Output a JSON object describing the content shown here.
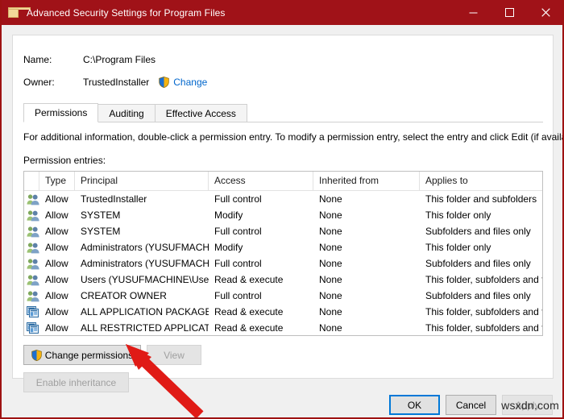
{
  "window": {
    "title": "Advanced Security Settings for Program Files",
    "icon": "folder-icon",
    "titlebar_color": "#a01218",
    "controls": {
      "minimize": "minimize-icon",
      "maximize": "maximize-icon",
      "close": "close-icon"
    }
  },
  "header": {
    "name_label": "Name:",
    "name_value": "C:\\Program Files",
    "owner_label": "Owner:",
    "owner_value": "TrustedInstaller",
    "owner_change_link": "Change",
    "shield_icon": "uac-shield-icon"
  },
  "tabs": [
    {
      "label": "Permissions",
      "active": true
    },
    {
      "label": "Auditing",
      "active": false
    },
    {
      "label": "Effective Access",
      "active": false
    }
  ],
  "info_text": "For additional information, double-click a permission entry. To modify a permission entry, select the entry and click Edit (if available).",
  "entries_label": "Permission entries:",
  "table": {
    "columns": [
      "",
      "Type",
      "Principal",
      "Access",
      "Inherited from",
      "Applies to"
    ],
    "rows": [
      {
        "icon": "users-group-icon",
        "type": "Allow",
        "principal": "TrustedInstaller",
        "access": "Full control",
        "inherited": "None",
        "applies": "This folder and subfolders"
      },
      {
        "icon": "users-group-icon",
        "type": "Allow",
        "principal": "SYSTEM",
        "access": "Modify",
        "inherited": "None",
        "applies": "This folder only"
      },
      {
        "icon": "users-group-icon",
        "type": "Allow",
        "principal": "SYSTEM",
        "access": "Full control",
        "inherited": "None",
        "applies": "Subfolders and files only"
      },
      {
        "icon": "users-group-icon",
        "type": "Allow",
        "principal": "Administrators (YUSUFMACH...",
        "access": "Modify",
        "inherited": "None",
        "applies": "This folder only"
      },
      {
        "icon": "users-group-icon",
        "type": "Allow",
        "principal": "Administrators (YUSUFMACH...",
        "access": "Full control",
        "inherited": "None",
        "applies": "Subfolders and files only"
      },
      {
        "icon": "users-group-icon",
        "type": "Allow",
        "principal": "Users (YUSUFMACHINE\\Users)",
        "access": "Read & execute",
        "inherited": "None",
        "applies": "This folder, subfolders and files"
      },
      {
        "icon": "users-group-icon",
        "type": "Allow",
        "principal": "CREATOR OWNER",
        "access": "Full control",
        "inherited": "None",
        "applies": "Subfolders and files only"
      },
      {
        "icon": "app-package-icon",
        "type": "Allow",
        "principal": "ALL APPLICATION PACKAGES",
        "access": "Read & execute",
        "inherited": "None",
        "applies": "This folder, subfolders and files"
      },
      {
        "icon": "app-package-icon",
        "type": "Allow",
        "principal": "ALL RESTRICTED APPLICATIO...",
        "access": "Read & execute",
        "inherited": "None",
        "applies": "This folder, subfolders and files"
      }
    ]
  },
  "actions": {
    "change_permissions": "Change permissions",
    "change_permissions_enabled": true,
    "view": "View",
    "view_enabled": false,
    "enable_inheritance": "Enable inheritance",
    "enable_inheritance_enabled": false
  },
  "footer": {
    "ok": "OK",
    "cancel": "Cancel",
    "apply": "Apply",
    "apply_enabled": false
  },
  "annotation": {
    "type": "red-arrow",
    "color": "#e01b16",
    "points_to": "change-permissions-button"
  },
  "watermark": "wsxdn.com"
}
